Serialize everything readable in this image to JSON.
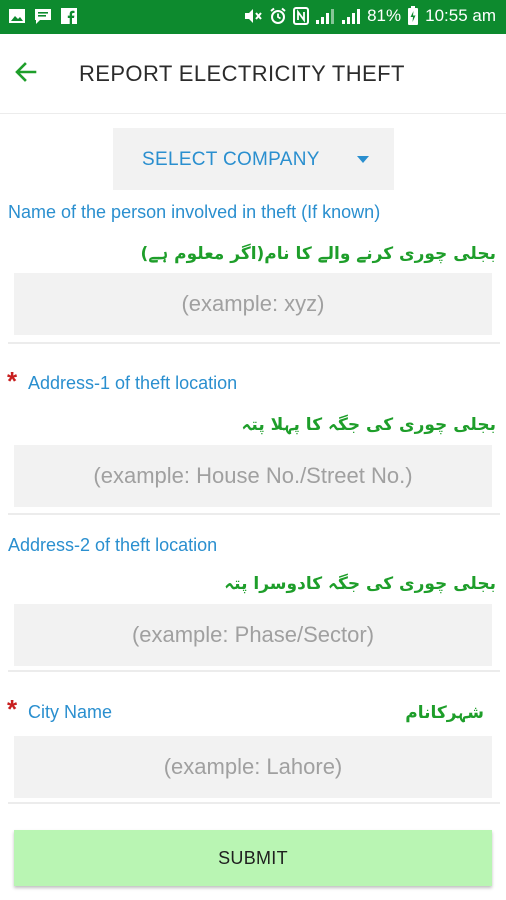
{
  "status_bar": {
    "battery_percent": "81%",
    "time": "10:55 am",
    "left_icons": [
      "image-icon",
      "message-icon",
      "facebook-icon"
    ],
    "right_icons": [
      "mute-icon",
      "alarm-icon",
      "nfc-icon",
      "signal-icon",
      "signal-icon",
      "battery-icon"
    ]
  },
  "header": {
    "title": "REPORT ELECTRICITY THEFT",
    "back_icon": "arrow-left-icon"
  },
  "company_select": {
    "label": "SELECT COMPANY"
  },
  "fields": [
    {
      "label_en": "Name of the person involved in theft (If known)",
      "label_ur": "بجلی چوری کرنے والے کا نام(اگر معلوم ہے)",
      "placeholder": "(example: xyz)",
      "required": false
    },
    {
      "label_en": "Address-1 of theft location",
      "label_ur": "بجلی چوری کی جگہ کا پہلا پتہ",
      "placeholder": "(example: House No./Street No.)",
      "required": true,
      "required_mark": "*"
    },
    {
      "label_en": "Address-2 of theft location",
      "label_ur": "بجلی چوری کی جگہ کادوسرا پتہ",
      "placeholder": "(example: Phase/Sector)",
      "required": false
    },
    {
      "label_en": "City Name",
      "label_ur": "شہرکانام",
      "placeholder": "(example: Lahore)",
      "required": true,
      "required_mark": "*"
    }
  ],
  "submit": {
    "label": "SUBMIT"
  },
  "colors": {
    "status_bar": "#0d8a2e",
    "accent_blue": "#2a8fcf",
    "urdu_green": "#1e9e2a",
    "required_red": "#c81f1f",
    "submit_bg": "#b9f5b3"
  }
}
